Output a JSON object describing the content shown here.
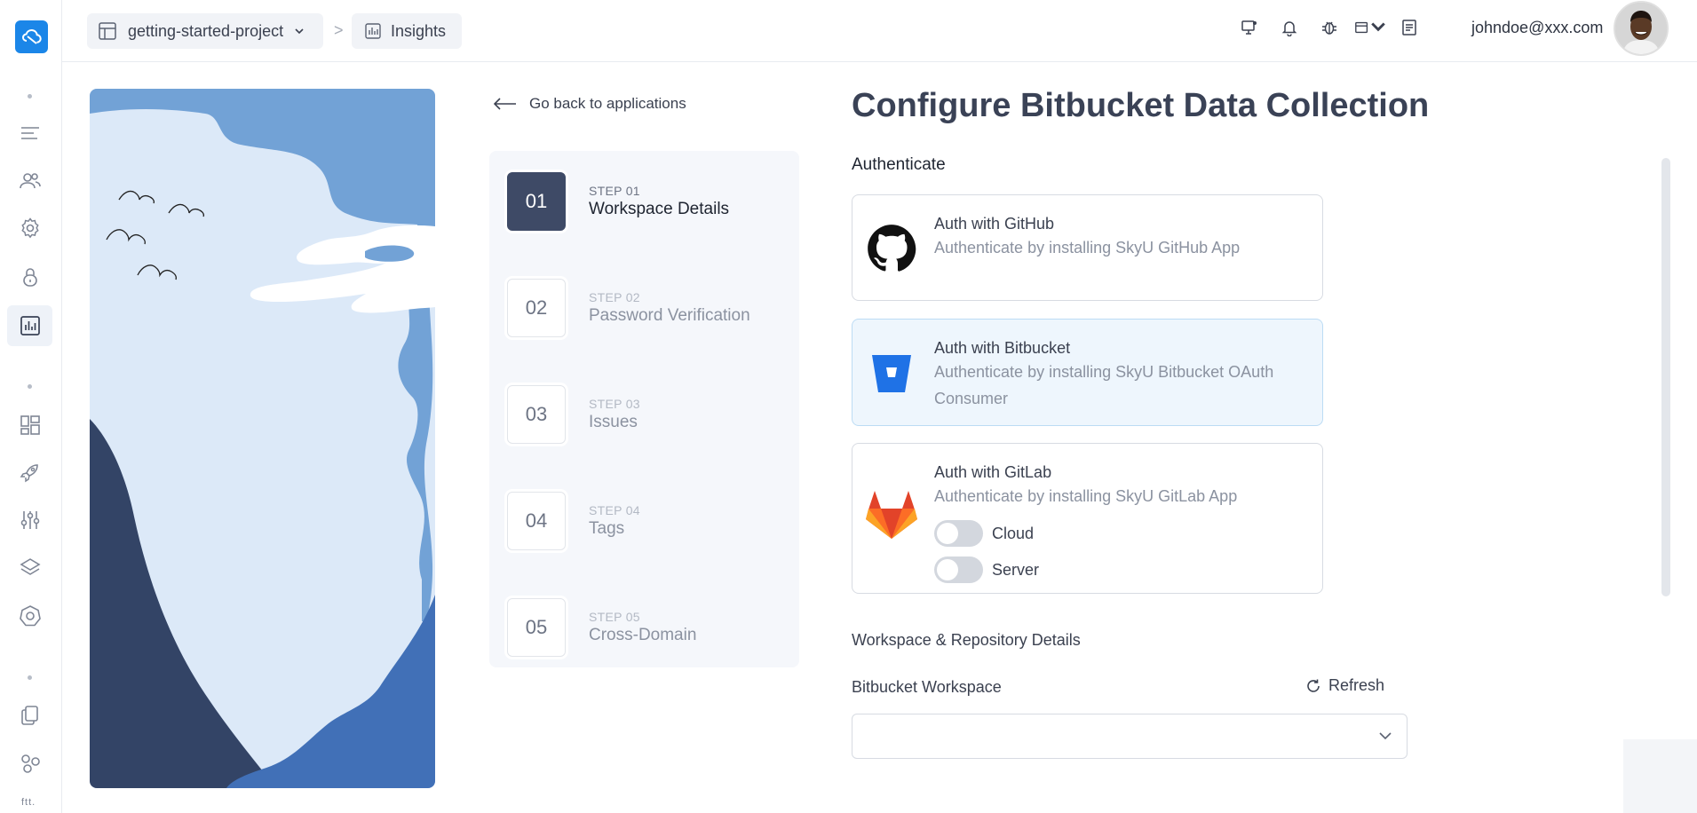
{
  "header": {
    "project": "getting-started-project",
    "separator": ">",
    "page": "Insights",
    "icons": [
      "monitor-icon",
      "bell-icon",
      "bug-icon",
      "window-icon",
      "document-icon"
    ],
    "user_email": "johndoe@xxx.com"
  },
  "sidebar": {
    "icons": [
      "menu-icon",
      "users-icon",
      "gear-icon",
      "lock-icon",
      "chart-icon",
      "dashboard-icon",
      "rocket-icon",
      "sliders-icon",
      "layers-icon",
      "helm-icon",
      "copy-icon",
      "nodes-icon"
    ],
    "active": "chart-icon"
  },
  "back_link": "Go back to applications",
  "steps": [
    {
      "num": "01",
      "label": "STEP 01",
      "title": "Workspace Details",
      "active": true
    },
    {
      "num": "02",
      "label": "STEP 02",
      "title": "Password Verification",
      "active": false
    },
    {
      "num": "03",
      "label": "STEP 03",
      "title": "Issues",
      "active": false
    },
    {
      "num": "04",
      "label": "STEP 04",
      "title": "Tags",
      "active": false
    },
    {
      "num": "05",
      "label": "STEP 05",
      "title": "Cross-Domain",
      "active": false
    }
  ],
  "form": {
    "title": "Configure Bitbucket Data Collection",
    "authenticate_heading": "Authenticate",
    "auth_options": [
      {
        "title": "Auth with GitHub",
        "description": "Authenticate by installing SkyU GitHub App",
        "selected": false
      },
      {
        "title": "Auth with Bitbucket",
        "description": "Authenticate by installing SkyU Bitbucket OAuth Consumer",
        "selected": true
      },
      {
        "title": "Auth with GitLab",
        "description": "Authenticate by installing SkyU GitLab App",
        "selected": false
      }
    ],
    "gitlab_toggles": [
      {
        "label": "Cloud",
        "on": false
      },
      {
        "label": "Server",
        "on": false
      }
    ],
    "workspace_heading": "Workspace & Repository Details",
    "workspace_label": "Bitbucket Workspace",
    "refresh_label": "Refresh",
    "workspace_value": ""
  },
  "colors": {
    "accent": "#1b86e8",
    "step_active": "#3e4a66",
    "selected_card": "#eef6fd"
  }
}
